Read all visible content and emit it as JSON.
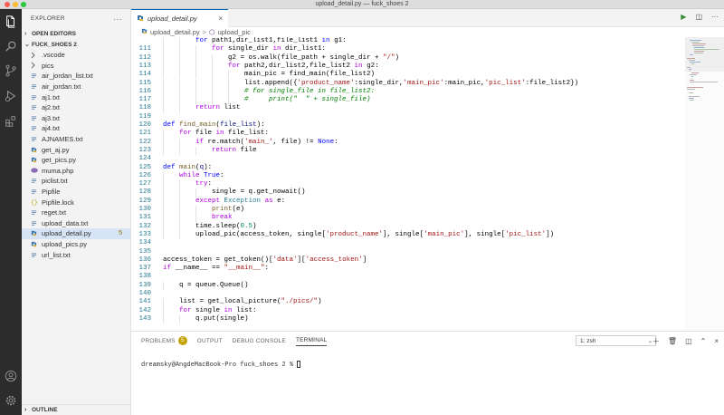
{
  "window": {
    "title": "upload_detail.py — fuck_shoes 2"
  },
  "sidebar": {
    "header": "EXPLORER",
    "more": "···",
    "sections": {
      "open_editors": "OPEN EDITORS",
      "project": "FUCK_SHOES 2",
      "outline": "OUTLINE"
    },
    "items": [
      {
        "label": ".vscode",
        "kind": "folder"
      },
      {
        "label": "pics",
        "kind": "folder"
      },
      {
        "label": "air_jordan_list.txt",
        "kind": "text"
      },
      {
        "label": "air_jordan.txt",
        "kind": "text"
      },
      {
        "label": "aj1.txt",
        "kind": "text"
      },
      {
        "label": "aj2.txt",
        "kind": "text"
      },
      {
        "label": "aj3.txt",
        "kind": "text"
      },
      {
        "label": "aj4.txt",
        "kind": "text"
      },
      {
        "label": "AJNAMES.txt",
        "kind": "text"
      },
      {
        "label": "get_aj.py",
        "kind": "python"
      },
      {
        "label": "get_pics.py",
        "kind": "python"
      },
      {
        "label": "muma.php",
        "kind": "php"
      },
      {
        "label": "piclist.txt",
        "kind": "text"
      },
      {
        "label": "Pipfile",
        "kind": "text"
      },
      {
        "label": "Pipfile.lock",
        "kind": "json"
      },
      {
        "label": "reget.txt",
        "kind": "text"
      },
      {
        "label": "upload_data.txt",
        "kind": "text"
      },
      {
        "label": "upload_detail.py",
        "kind": "python",
        "count": "5",
        "selected": true
      },
      {
        "label": "upload_pics.py",
        "kind": "python"
      },
      {
        "label": "url_list.txt",
        "kind": "text"
      }
    ]
  },
  "editor": {
    "tab": {
      "label": "upload_detail.py",
      "close": "×"
    },
    "breadcrumbs": {
      "file": "upload_detail.py",
      "symbol": "upload_pic",
      "sep": ">"
    },
    "code_lines": [
      {
        "n": "",
        "indent": 2,
        "tokens": [
          [
            "kw",
            "for"
          ],
          [
            "pl",
            " path1,dir_list1,file_list1 "
          ],
          [
            "kw",
            "in"
          ],
          [
            "pl",
            " g1:"
          ]
        ]
      },
      {
        "n": "111",
        "indent": 3,
        "tokens": [
          [
            "cf",
            "for"
          ],
          [
            "pl",
            " single_dir "
          ],
          [
            "cf",
            "in"
          ],
          [
            "pl",
            " dir_list1:"
          ]
        ]
      },
      {
        "n": "112",
        "indent": 4,
        "tokens": [
          [
            "pl",
            "g2 = os.walk(file_path + single_dir + "
          ],
          [
            "str",
            "\"/\""
          ],
          [
            "pl",
            ")"
          ]
        ]
      },
      {
        "n": "113",
        "indent": 4,
        "tokens": [
          [
            "cf",
            "for"
          ],
          [
            "pl",
            " path2,dir_list2,file_list2 "
          ],
          [
            "cf",
            "in"
          ],
          [
            "pl",
            " g2:"
          ]
        ]
      },
      {
        "n": "114",
        "indent": 5,
        "tokens": [
          [
            "pl",
            "main_pic = find_main(file_list2)"
          ]
        ]
      },
      {
        "n": "115",
        "indent": 5,
        "tokens": [
          [
            "pl",
            "list.append({"
          ],
          [
            "str",
            "'product_name'"
          ],
          [
            "pl",
            ":single_dir,"
          ],
          [
            "str",
            "'main_pic'"
          ],
          [
            "pl",
            ":main_pic,"
          ],
          [
            "str",
            "'pic_list'"
          ],
          [
            "pl",
            ":file_list2})"
          ]
        ]
      },
      {
        "n": "116",
        "indent": 5,
        "tokens": [
          [
            "cm",
            "# for single_file in file_list2:"
          ]
        ]
      },
      {
        "n": "117",
        "indent": 5,
        "tokens": [
          [
            "cm",
            "#     print(\"  \" + single_file)"
          ]
        ]
      },
      {
        "n": "118",
        "indent": 2,
        "tokens": [
          [
            "cf",
            "return"
          ],
          [
            "pl",
            " list"
          ]
        ]
      },
      {
        "n": "119",
        "indent": 0,
        "tokens": []
      },
      {
        "n": "120",
        "indent": 0,
        "tokens": [
          [
            "kw",
            "def"
          ],
          [
            "pl",
            " "
          ],
          [
            "fn",
            "find_main"
          ],
          [
            "pl",
            "("
          ],
          [
            "sf",
            "file_list"
          ],
          [
            "pl",
            "):"
          ]
        ]
      },
      {
        "n": "121",
        "indent": 1,
        "tokens": [
          [
            "cf",
            "for"
          ],
          [
            "pl",
            " file "
          ],
          [
            "cf",
            "in"
          ],
          [
            "pl",
            " file_list:"
          ]
        ]
      },
      {
        "n": "122",
        "indent": 2,
        "tokens": [
          [
            "cf",
            "if"
          ],
          [
            "pl",
            " re.match("
          ],
          [
            "str",
            "'main_'"
          ],
          [
            "pl",
            ", file) != "
          ],
          [
            "kw",
            "None"
          ],
          [
            "pl",
            ":"
          ]
        ]
      },
      {
        "n": "123",
        "indent": 3,
        "tokens": [
          [
            "cf",
            "return"
          ],
          [
            "pl",
            " file"
          ]
        ]
      },
      {
        "n": "124",
        "indent": 0,
        "tokens": []
      },
      {
        "n": "125",
        "indent": 0,
        "tokens": [
          [
            "kw",
            "def"
          ],
          [
            "pl",
            " "
          ],
          [
            "fn",
            "main"
          ],
          [
            "pl",
            "("
          ],
          [
            "sf",
            "q"
          ],
          [
            "pl",
            "):"
          ]
        ]
      },
      {
        "n": "126",
        "indent": 1,
        "tokens": [
          [
            "cf",
            "while"
          ],
          [
            "pl",
            " "
          ],
          [
            "kw",
            "True"
          ],
          [
            "pl",
            ":"
          ]
        ]
      },
      {
        "n": "127",
        "indent": 2,
        "tokens": [
          [
            "cf",
            "try"
          ],
          [
            "pl",
            ":"
          ]
        ]
      },
      {
        "n": "128",
        "indent": 3,
        "tokens": [
          [
            "pl",
            "single = q.get_nowait()"
          ]
        ]
      },
      {
        "n": "129",
        "indent": 2,
        "tokens": [
          [
            "cf",
            "except"
          ],
          [
            "pl",
            " "
          ],
          [
            "ex",
            "Exception"
          ],
          [
            "pl",
            " "
          ],
          [
            "cf",
            "as"
          ],
          [
            "pl",
            " e:"
          ]
        ]
      },
      {
        "n": "130",
        "indent": 3,
        "tokens": [
          [
            "fn",
            "print"
          ],
          [
            "pl",
            "(e)"
          ]
        ]
      },
      {
        "n": "131",
        "indent": 3,
        "tokens": [
          [
            "cf",
            "break"
          ]
        ]
      },
      {
        "n": "132",
        "indent": 2,
        "tokens": [
          [
            "pl",
            "time.sleep("
          ],
          [
            "num",
            "0.5"
          ],
          [
            "pl",
            ")"
          ]
        ]
      },
      {
        "n": "133",
        "indent": 2,
        "tokens": [
          [
            "pl",
            "upload_pic(access_token, single["
          ],
          [
            "str",
            "'product_name'"
          ],
          [
            "pl",
            "], single["
          ],
          [
            "str",
            "'main_pic'"
          ],
          [
            "pl",
            "], single["
          ],
          [
            "str",
            "'pic_list'"
          ],
          [
            "pl",
            "])"
          ]
        ]
      },
      {
        "n": "134",
        "indent": 0,
        "tokens": []
      },
      {
        "n": "135",
        "indent": 0,
        "tokens": []
      },
      {
        "n": "136",
        "indent": 0,
        "tokens": [
          [
            "pl",
            "access_token = get_token()["
          ],
          [
            "str",
            "'data'"
          ],
          [
            "pl",
            "]["
          ],
          [
            "str",
            "'access_token'"
          ],
          [
            "pl",
            "]"
          ]
        ]
      },
      {
        "n": "137",
        "indent": 0,
        "tokens": [
          [
            "cf",
            "if"
          ],
          [
            "pl",
            " __name__ == "
          ],
          [
            "str",
            "\"__main__\""
          ],
          [
            "pl",
            ":"
          ]
        ]
      },
      {
        "n": "138",
        "indent": 0,
        "tokens": []
      },
      {
        "n": "139",
        "indent": 1,
        "tokens": [
          [
            "pl",
            "q = queue.Queue()"
          ]
        ]
      },
      {
        "n": "140",
        "indent": 0,
        "tokens": []
      },
      {
        "n": "141",
        "indent": 1,
        "tokens": [
          [
            "pl",
            "list = get_local_picture("
          ],
          [
            "str",
            "\"./pics/\""
          ],
          [
            "pl",
            ")"
          ]
        ]
      },
      {
        "n": "142",
        "indent": 1,
        "tokens": [
          [
            "cf",
            "for"
          ],
          [
            "pl",
            " single "
          ],
          [
            "cf",
            "in"
          ],
          [
            "pl",
            " list:"
          ]
        ]
      },
      {
        "n": "143",
        "indent": 2,
        "tokens": [
          [
            "pl",
            "q.put(single)"
          ]
        ]
      }
    ]
  },
  "panel": {
    "tabs": {
      "problems": "PROBLEMS",
      "problems_count": "5",
      "output": "OUTPUT",
      "debug": "DEBUG CONSOLE",
      "terminal": "TERMINAL"
    },
    "terminal_select": "1: zsh",
    "terminal_prompt": "dreamsky@AngdeMacBook-Pro fuck_shoes 2 % "
  },
  "colors": {
    "accent": "#0066b8",
    "activity_bar": "#2c2c2c",
    "selection": "#d6e4f5",
    "warning_badge": "#c5a300",
    "run_green": "#388a34"
  }
}
